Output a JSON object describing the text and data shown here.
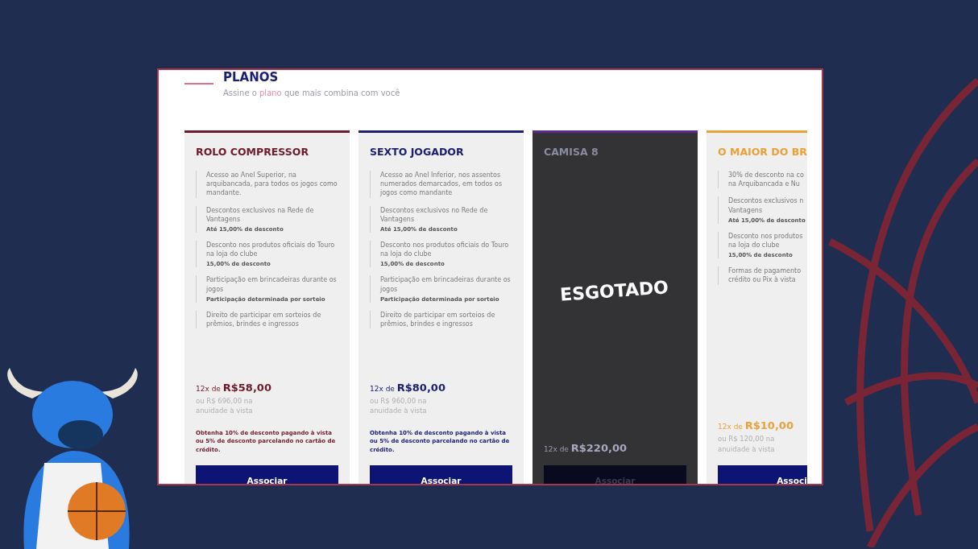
{
  "section": {
    "title": "PLANOS",
    "subtitle": {
      "before": "Assine o ",
      "highlight": "plano",
      "after": " que mais combina com você"
    }
  },
  "plans": [
    {
      "title": "ROLO COMPRESSOR",
      "color": "#6e1a2c",
      "sold_out": false,
      "features": [
        {
          "text": "Acesso ao Anel Superior, na arquibancada, para todos os jogos como mandante."
        },
        {
          "text": "Descontos exclusivos na Rede de Vantagens",
          "note": "Até 15,00% de desconto"
        },
        {
          "text": "Desconto nos produtos oficiais do Touro na loja do clube",
          "note": "15,00% de desconto"
        },
        {
          "text": "Participação em brincadeiras durante os jogos",
          "note": "Participação determinada por sorteio"
        },
        {
          "text": "Direito de participar em sorteios de prêmios, brindes e ingressos"
        }
      ],
      "price_prefix": "12x de ",
      "price": "R$58,00",
      "price_note": "ou R$ 696,00 na\nanuidade à vista",
      "promo": "Obtenha 10% de desconto pagando à vista ou 5% de desconto parcelando no cartão de crédito.",
      "button": "Associar"
    },
    {
      "title": "SEXTO JOGADOR",
      "color": "#1c2070",
      "sold_out": false,
      "features": [
        {
          "text": "Acesso ao Anel Inferior, nos assentos numerados demarcados, em todos os jogos como mandante"
        },
        {
          "text": "Descontos exclusivos no Rede de Vantagens",
          "note": "Até 15,00% de desconto"
        },
        {
          "text": "Desconto nos produtos oficiais do Touro na loja do clube",
          "note": "15,00% de desconto"
        },
        {
          "text": "Participação em brincadeiras durante os jogos",
          "note": "Participação determinada por sorteio"
        },
        {
          "text": "Direito de participar em sorteios de prêmios, brindes e ingressos"
        }
      ],
      "price_prefix": "12x de ",
      "price": "R$80,00",
      "price_note": "ou R$ 960,00 na\nanuidade à vista",
      "promo": "Obtenha 10% de desconto pagando à vista ou 5% de desconto parcelando no cartão de crédito.",
      "button": "Associar"
    },
    {
      "title": "CAMISA 8",
      "color": "#5b2a8c",
      "sold_out": true,
      "overlay_label": "ESGOTADO",
      "price_prefix": "12x de ",
      "price": "R$220,00",
      "button": "Associar"
    },
    {
      "title": "O MAIOR DO BR",
      "color": "#e8a23a",
      "sold_out": false,
      "features": [
        {
          "text": "30% de desconto na co\nna Arquibancada e Nu"
        },
        {
          "text": "Descontos exclusivos n\nVantagens",
          "note": "Até 15,00% de desconto"
        },
        {
          "text": "Desconto nos produtos\nna loja do clube",
          "note": "15,00% de desconto"
        },
        {
          "text": "Formas de pagamento\ncrédito ou Pix à vista"
        }
      ],
      "price_prefix": "12x de ",
      "price": "R$10,00",
      "price_note": "ou R$ 120,00 na\nanuidade à vista",
      "button": "Associ"
    }
  ]
}
